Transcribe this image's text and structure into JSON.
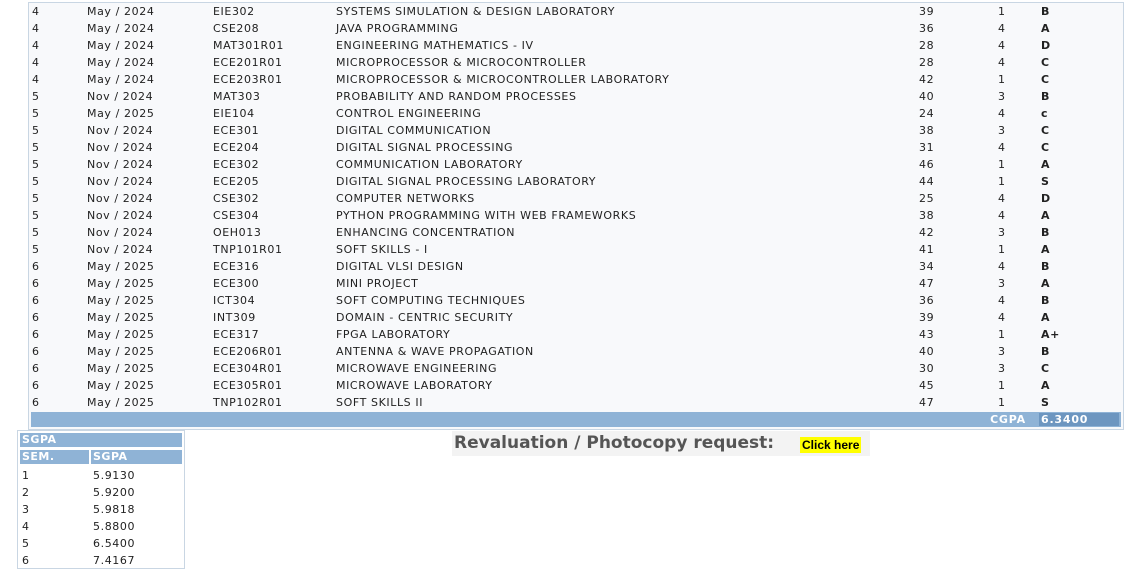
{
  "results": {
    "rows": [
      {
        "sem": "4",
        "session": "May / 2024",
        "code": "EIE302",
        "name": "SYSTEMS SIMULATION & DESIGN LABORATORY",
        "internal": "39",
        "credit": "1",
        "grade": "B"
      },
      {
        "sem": "4",
        "session": "May / 2024",
        "code": "CSE208",
        "name": "JAVA PROGRAMMING",
        "internal": "36",
        "credit": "4",
        "grade": "A"
      },
      {
        "sem": "4",
        "session": "May / 2024",
        "code": "MAT301R01",
        "name": "ENGINEERING MATHEMATICS - IV",
        "internal": "28",
        "credit": "4",
        "grade": "D"
      },
      {
        "sem": "4",
        "session": "May / 2024",
        "code": "ECE201R01",
        "name": "MICROPROCESSOR & MICROCONTROLLER",
        "internal": "28",
        "credit": "4",
        "grade": "C"
      },
      {
        "sem": "4",
        "session": "May / 2024",
        "code": "ECE203R01",
        "name": "MICROPROCESSOR & MICROCONTROLLER LABORATORY",
        "internal": "42",
        "credit": "1",
        "grade": "C"
      },
      {
        "sem": "5",
        "session": "Nov / 2024",
        "code": "MAT303",
        "name": "PROBABILITY AND RANDOM PROCESSES",
        "internal": "40",
        "credit": "3",
        "grade": "B"
      },
      {
        "sem": "5",
        "session": "May / 2025",
        "code": "EIE104",
        "name": "CONTROL ENGINEERING",
        "internal": "24",
        "credit": "4",
        "grade": "c"
      },
      {
        "sem": "5",
        "session": "Nov / 2024",
        "code": "ECE301",
        "name": "DIGITAL COMMUNICATION",
        "internal": "38",
        "credit": "3",
        "grade": "C"
      },
      {
        "sem": "5",
        "session": "Nov / 2024",
        "code": "ECE204",
        "name": "DIGITAL SIGNAL PROCESSING",
        "internal": "31",
        "credit": "4",
        "grade": "C"
      },
      {
        "sem": "5",
        "session": "Nov / 2024",
        "code": "ECE302",
        "name": "COMMUNICATION LABORATORY",
        "internal": "46",
        "credit": "1",
        "grade": "A"
      },
      {
        "sem": "5",
        "session": "Nov / 2024",
        "code": "ECE205",
        "name": "DIGITAL SIGNAL PROCESSING LABORATORY",
        "internal": "44",
        "credit": "1",
        "grade": "S"
      },
      {
        "sem": "5",
        "session": "Nov / 2024",
        "code": "CSE302",
        "name": "COMPUTER NETWORKS",
        "internal": "25",
        "credit": "4",
        "grade": "D"
      },
      {
        "sem": "5",
        "session": "Nov / 2024",
        "code": "CSE304",
        "name": "PYTHON PROGRAMMING WITH WEB FRAMEWORKS",
        "internal": "38",
        "credit": "4",
        "grade": "A"
      },
      {
        "sem": "5",
        "session": "Nov / 2024",
        "code": "OEH013",
        "name": "ENHANCING CONCENTRATION",
        "internal": "42",
        "credit": "3",
        "grade": "B"
      },
      {
        "sem": "5",
        "session": "Nov / 2024",
        "code": "TNP101R01",
        "name": "SOFT SKILLS - I",
        "internal": "41",
        "credit": "1",
        "grade": "A"
      },
      {
        "sem": "6",
        "session": "May / 2025",
        "code": "ECE316",
        "name": "DIGITAL VLSI DESIGN",
        "internal": "34",
        "credit": "4",
        "grade": "B"
      },
      {
        "sem": "6",
        "session": "May / 2025",
        "code": "ECE300",
        "name": "MINI PROJECT",
        "internal": "47",
        "credit": "3",
        "grade": "A"
      },
      {
        "sem": "6",
        "session": "May / 2025",
        "code": "ICT304",
        "name": "SOFT COMPUTING TECHNIQUES",
        "internal": "36",
        "credit": "4",
        "grade": "B"
      },
      {
        "sem": "6",
        "session": "May / 2025",
        "code": "INT309",
        "name": "DOMAIN - CENTRIC SECURITY",
        "internal": "39",
        "credit": "4",
        "grade": "A"
      },
      {
        "sem": "6",
        "session": "May / 2025",
        "code": "ECE317",
        "name": "FPGA LABORATORY",
        "internal": "43",
        "credit": "1",
        "grade": "A+"
      },
      {
        "sem": "6",
        "session": "May / 2025",
        "code": "ECE206R01",
        "name": "ANTENNA & WAVE PROPAGATION",
        "internal": "40",
        "credit": "3",
        "grade": "B"
      },
      {
        "sem": "6",
        "session": "May / 2025",
        "code": "ECE304R01",
        "name": "MICROWAVE ENGINEERING",
        "internal": "30",
        "credit": "3",
        "grade": "C"
      },
      {
        "sem": "6",
        "session": "May / 2025",
        "code": "ECE305R01",
        "name": "MICROWAVE LABORATORY",
        "internal": "45",
        "credit": "1",
        "grade": "A"
      },
      {
        "sem": "6",
        "session": "May / 2025",
        "code": "TNP102R01",
        "name": "SOFT SKILLS II",
        "internal": "47",
        "credit": "1",
        "grade": "S"
      }
    ],
    "cgpa_label": "CGPA",
    "cgpa_value": "6.3400"
  },
  "sgpa": {
    "title": "SGPA",
    "col_sem": "SEM.",
    "col_sgpa": "SGPA",
    "rows": [
      {
        "sem": "1",
        "sgpa": "5.9130"
      },
      {
        "sem": "2",
        "sgpa": "5.9200"
      },
      {
        "sem": "3",
        "sgpa": "5.9818"
      },
      {
        "sem": "4",
        "sgpa": "5.8800"
      },
      {
        "sem": "5",
        "sgpa": "6.5400"
      },
      {
        "sem": "6",
        "sgpa": "7.4167"
      }
    ]
  },
  "revaluation": {
    "text": "Revaluation / Photocopy request:",
    "link_label": "Click here",
    "link_color": "#ffff00"
  }
}
